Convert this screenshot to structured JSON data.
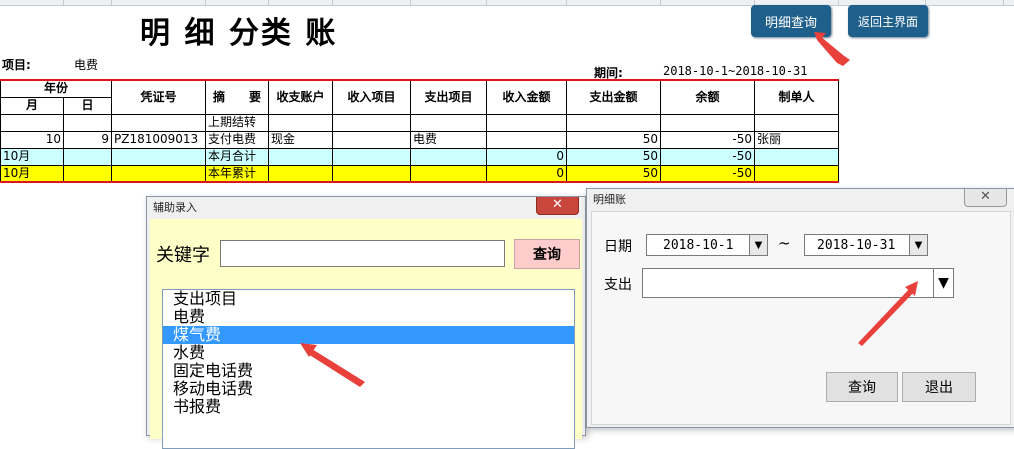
{
  "sheet": {
    "title": "明 细 分类 账",
    "project_label": "项目:",
    "project_value": "电费",
    "period_label": "期间:",
    "period_value": "2018-10-1~2018-10-31",
    "detail_query_button": "明细查询",
    "back_main_button": "返回主界面"
  },
  "table": {
    "headers": {
      "year": "年份",
      "month": "月",
      "day": "日",
      "voucher": "凭证号",
      "summary": "摘　　要",
      "account": "收支账户",
      "income_item": "收入项目",
      "expense_item": "支出项目",
      "income_amt": "收入金额",
      "expense_amt": "支出金额",
      "balance": "余额",
      "creator": "制单人"
    },
    "rows": [
      {
        "month": "",
        "day": "",
        "voucher": "",
        "summary": "上期结转",
        "account": "",
        "income_item": "",
        "expense_item": "",
        "income_amt": "",
        "expense_amt": "",
        "balance": "",
        "creator": "",
        "style": "plain"
      },
      {
        "month": "10",
        "day": "9",
        "voucher": "PZ181009013",
        "summary": "支付电费",
        "account": "现金",
        "income_item": "",
        "expense_item": "电费",
        "income_amt": "",
        "expense_amt": "50",
        "balance": "-50",
        "creator": "张丽",
        "style": "plain"
      },
      {
        "month": "10月",
        "day": "",
        "voucher": "",
        "summary": "本月合计",
        "account": "",
        "income_item": "",
        "expense_item": "",
        "income_amt": "0",
        "expense_amt": "50",
        "balance": "-50",
        "creator": "",
        "style": "cyan"
      },
      {
        "month": "10月",
        "day": "",
        "voucher": "",
        "summary": "本年累计",
        "account": "",
        "income_item": "",
        "expense_item": "",
        "income_amt": "0",
        "expense_amt": "50",
        "balance": "-50",
        "creator": "",
        "style": "yellow"
      }
    ]
  },
  "aux_dialog": {
    "title": "辅助录入",
    "keyword_label": "关键字",
    "keyword_value": "",
    "query_button": "查询",
    "list_items": [
      "支出项目",
      "电费",
      "煤气费",
      "水费",
      "固定电话费",
      "移动电话费",
      "书报费"
    ],
    "selected_item": "煤气费"
  },
  "detail_dialog": {
    "title": "明细账",
    "date_label": "日期",
    "date_from": "2018-10-1",
    "range_sep": "~",
    "date_to": "2018-10-31",
    "expense_label": "支出",
    "expense_value": "",
    "query_button": "查询",
    "exit_button": "退出"
  },
  "colors": {
    "accent_button": "#1f5f8b",
    "table_border": "#e0141e",
    "row_cyan": "#ccffff",
    "row_yellow": "#ffff00",
    "aux_dialog_bg": "#ffffc8",
    "query_button_bg": "#ffcccc",
    "list_selected": "#3399ff",
    "callout_arrow": "#e8413c"
  },
  "icons": [
    "close-icon",
    "dropdown-arrow-icon",
    "callout-arrow-icon"
  ]
}
